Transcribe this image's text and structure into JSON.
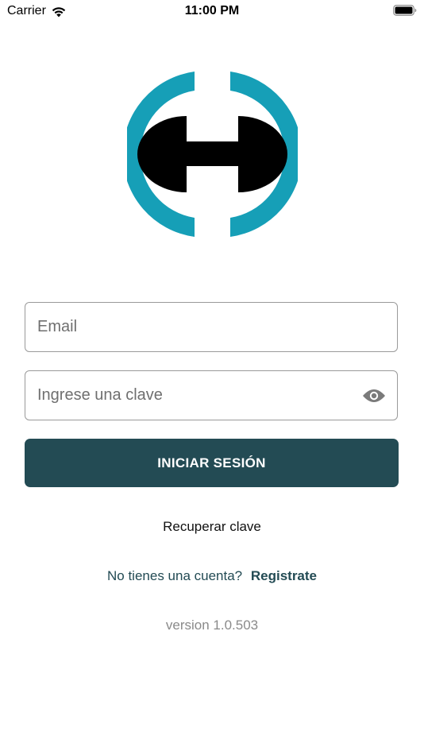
{
  "status_bar": {
    "carrier": "Carrier",
    "time": "11:00 PM",
    "wifi_icon": "wifi-icon",
    "battery_icon": "battery-full-icon"
  },
  "logo": {
    "icon": "h-logo-icon",
    "colors": {
      "ring": "#169fb7",
      "letter": "#000000"
    }
  },
  "form": {
    "email": {
      "placeholder": "Email",
      "value": ""
    },
    "password": {
      "placeholder": "Ingrese una clave",
      "value": "",
      "toggle_icon": "eye-icon"
    },
    "login_label": "INICIAR SESIÓN",
    "recover_label": "Recuperar clave",
    "register_prompt": "No tienes una cuenta?",
    "register_label": "Registrate"
  },
  "version": "version 1.0.503",
  "colors": {
    "primary": "#234b54",
    "accent": "#169fb7",
    "muted": "#8a8a8a"
  }
}
